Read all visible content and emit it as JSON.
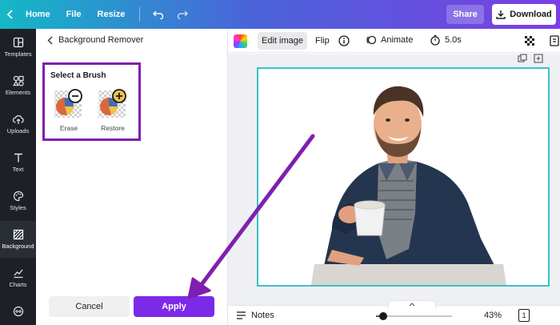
{
  "topbar": {
    "home": "Home",
    "file": "File",
    "resize": "Resize",
    "share": "Share",
    "download": "Download"
  },
  "rail": {
    "items": [
      {
        "label": "Templates",
        "icon": "layout-icon"
      },
      {
        "label": "Elements",
        "icon": "shapes-icon"
      },
      {
        "label": "Uploads",
        "icon": "cloud-upload-icon"
      },
      {
        "label": "Text",
        "icon": "text-icon"
      },
      {
        "label": "Styles",
        "icon": "palette-icon"
      },
      {
        "label": "Background",
        "icon": "hatch-icon"
      },
      {
        "label": "Charts",
        "icon": "chart-line-icon"
      }
    ]
  },
  "panel": {
    "title": "Background Remover",
    "brush_title": "Select a Brush",
    "erase": "Erase",
    "restore": "Restore",
    "cancel": "Cancel",
    "apply": "Apply"
  },
  "toolbar": {
    "edit_image": "Edit image",
    "flip": "Flip",
    "animate": "Animate",
    "duration": "5.0s"
  },
  "status": {
    "notes": "Notes",
    "zoom": "43%",
    "zoom_fraction": 0.09,
    "page": "1"
  },
  "colors": {
    "accent": "#7d2ae8",
    "highlight_border": "#7f1fb0",
    "canvas_selection": "#37c2c9"
  }
}
